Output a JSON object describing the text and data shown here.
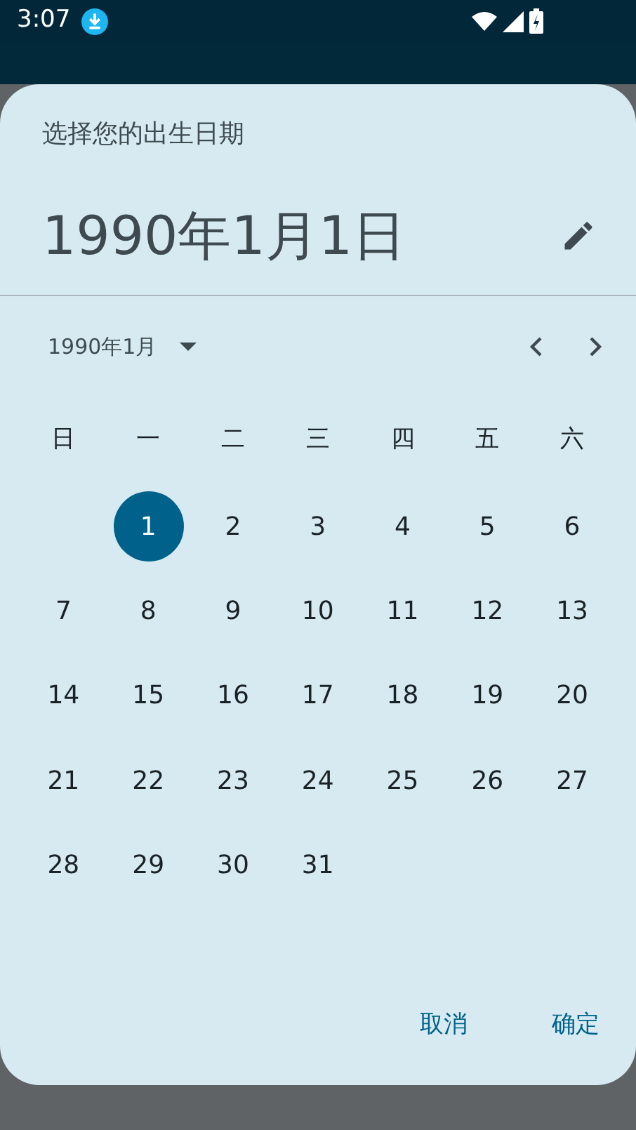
{
  "status_bar": {
    "time": "3:07"
  },
  "dialog": {
    "title": "选择您的出生日期",
    "selected_date": "1990年1月1日",
    "month_label": "1990年1月",
    "weekdays": [
      "日",
      "一",
      "二",
      "三",
      "四",
      "五",
      "六"
    ],
    "weeks": [
      [
        {
          "label": "1",
          "selected": true
        },
        {
          "label": "2",
          "selected": false
        },
        {
          "label": "3",
          "selected": false
        },
        {
          "label": "4",
          "selected": false
        },
        {
          "label": "5",
          "selected": false
        },
        {
          "label": "6",
          "selected": false
        }
      ],
      [
        {
          "label": "7",
          "selected": false
        },
        {
          "label": "8",
          "selected": false
        },
        {
          "label": "9",
          "selected": false
        },
        {
          "label": "10",
          "selected": false
        },
        {
          "label": "11",
          "selected": false
        },
        {
          "label": "12",
          "selected": false
        },
        {
          "label": "13",
          "selected": false
        }
      ],
      [
        {
          "label": "14",
          "selected": false
        },
        {
          "label": "15",
          "selected": false
        },
        {
          "label": "16",
          "selected": false
        },
        {
          "label": "17",
          "selected": false
        },
        {
          "label": "18",
          "selected": false
        },
        {
          "label": "19",
          "selected": false
        },
        {
          "label": "20",
          "selected": false
        }
      ],
      [
        {
          "label": "21",
          "selected": false
        },
        {
          "label": "22",
          "selected": false
        },
        {
          "label": "23",
          "selected": false
        },
        {
          "label": "24",
          "selected": false
        },
        {
          "label": "25",
          "selected": false
        },
        {
          "label": "26",
          "selected": false
        },
        {
          "label": "27",
          "selected": false
        }
      ],
      [
        {
          "label": "28",
          "selected": false
        },
        {
          "label": "29",
          "selected": false
        },
        {
          "label": "30",
          "selected": false
        },
        {
          "label": "31",
          "selected": false
        }
      ]
    ],
    "buttons": [
      "取消",
      "确定"
    ]
  }
}
